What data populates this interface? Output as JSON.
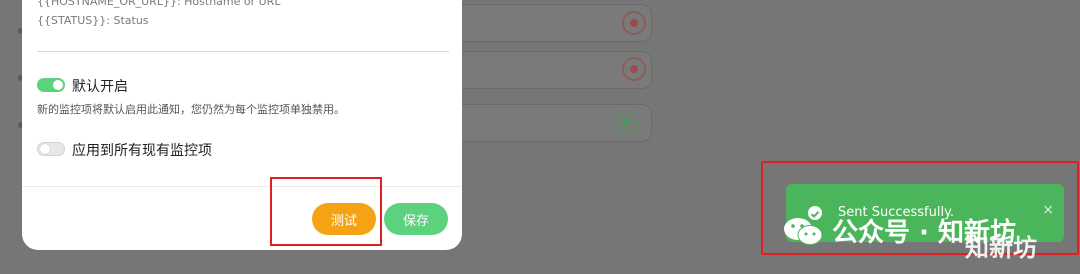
{
  "modal": {
    "hint_hostname": "{{HOSTNAME_OR_URL}}: Hostname or URL",
    "hint_status": "{{STATUS}}: Status",
    "default_enabled": {
      "label": "默认开启",
      "description": "新的监控项将默认启用此通知，您仍然为每个监控项单独禁用。",
      "on": true
    },
    "apply_all": {
      "label": "应用到所有现有监控项",
      "on": false
    },
    "buttons": {
      "test": "测试",
      "save": "保存"
    }
  },
  "toast": {
    "message": "Sent Successfully.",
    "close": "×",
    "icon": "check-circle-icon"
  },
  "watermark": {
    "text": "公众号 · 知新坊",
    "logo_text": "知新坊"
  },
  "colors": {
    "toast": "#4ab55a",
    "test_button": "#f5a214",
    "save_button": "#5cd17e",
    "highlight": "#e02020"
  }
}
